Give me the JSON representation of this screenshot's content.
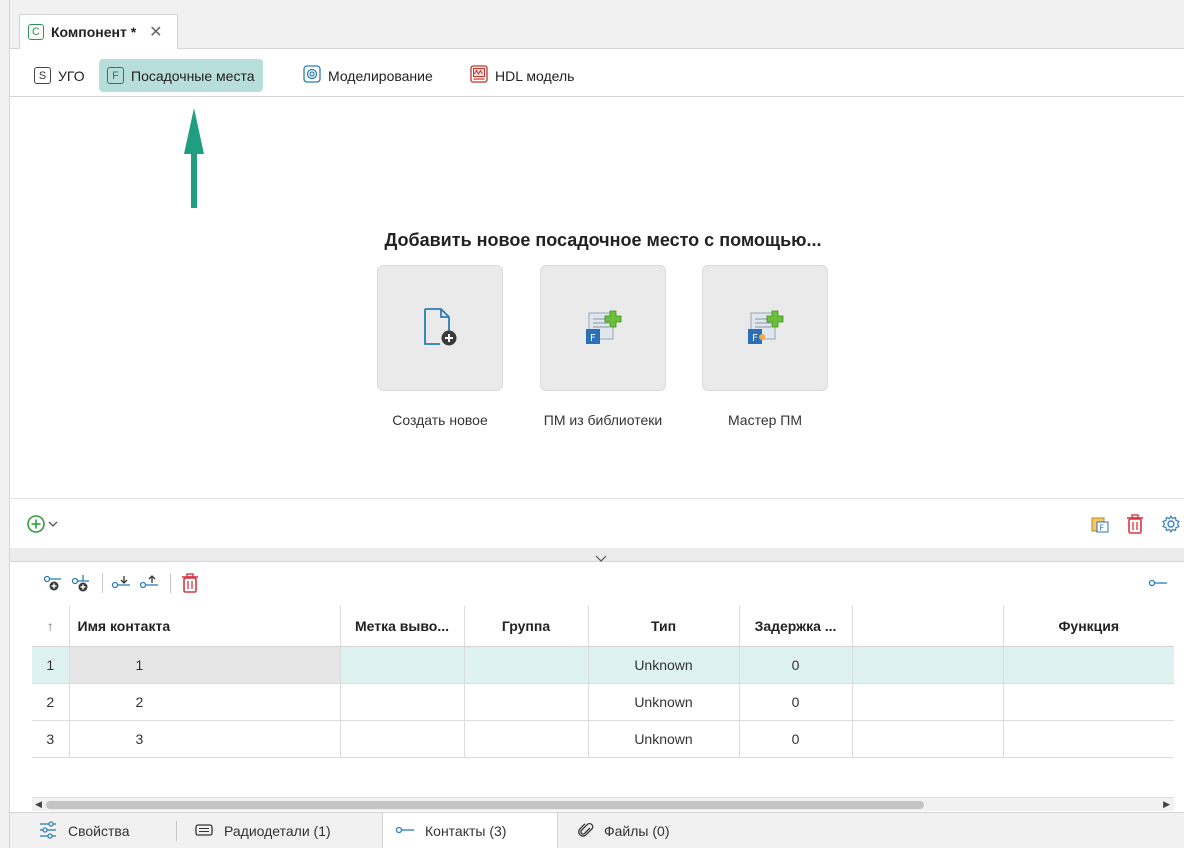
{
  "document_tab": {
    "letter": "C",
    "title": "Компонент *",
    "close": "✕"
  },
  "view_tabs": [
    {
      "letter": "S",
      "label": "УГО"
    },
    {
      "letter": "F",
      "label": "Посадочные места"
    },
    {
      "label": "Моделирование"
    },
    {
      "label": "HDL модель"
    }
  ],
  "heading": "Добавить новое посадочное место с помощью...",
  "cards": [
    {
      "label": "Создать новое"
    },
    {
      "label": "ПМ из библиотеки"
    },
    {
      "label": "Мастер ПМ"
    }
  ],
  "table": {
    "sort_indicator": "↑",
    "columns": [
      "Имя контакта",
      "Метка выво...",
      "Группа",
      "Тип",
      "Задержка ...",
      "",
      "Функция"
    ],
    "rows": [
      {
        "num": "1",
        "name": "1",
        "label": "",
        "group": "",
        "type": "Unknown",
        "delay": "0",
        "extra": "",
        "func": ""
      },
      {
        "num": "2",
        "name": "2",
        "label": "",
        "group": "",
        "type": "Unknown",
        "delay": "0",
        "extra": "",
        "func": ""
      },
      {
        "num": "3",
        "name": "3",
        "label": "",
        "group": "",
        "type": "Unknown",
        "delay": "0",
        "extra": "",
        "func": ""
      }
    ]
  },
  "bottom_tabs": [
    {
      "label": "Свойства"
    },
    {
      "label": "Радиодетали (1)"
    },
    {
      "label": "Контакты (3)"
    },
    {
      "label": "Файлы (0)"
    }
  ],
  "colors": {
    "accent": "#1f9e82",
    "active_tab": "#b7dedb",
    "selected_row": "#dff2f2",
    "delete_red": "#d9363e"
  }
}
